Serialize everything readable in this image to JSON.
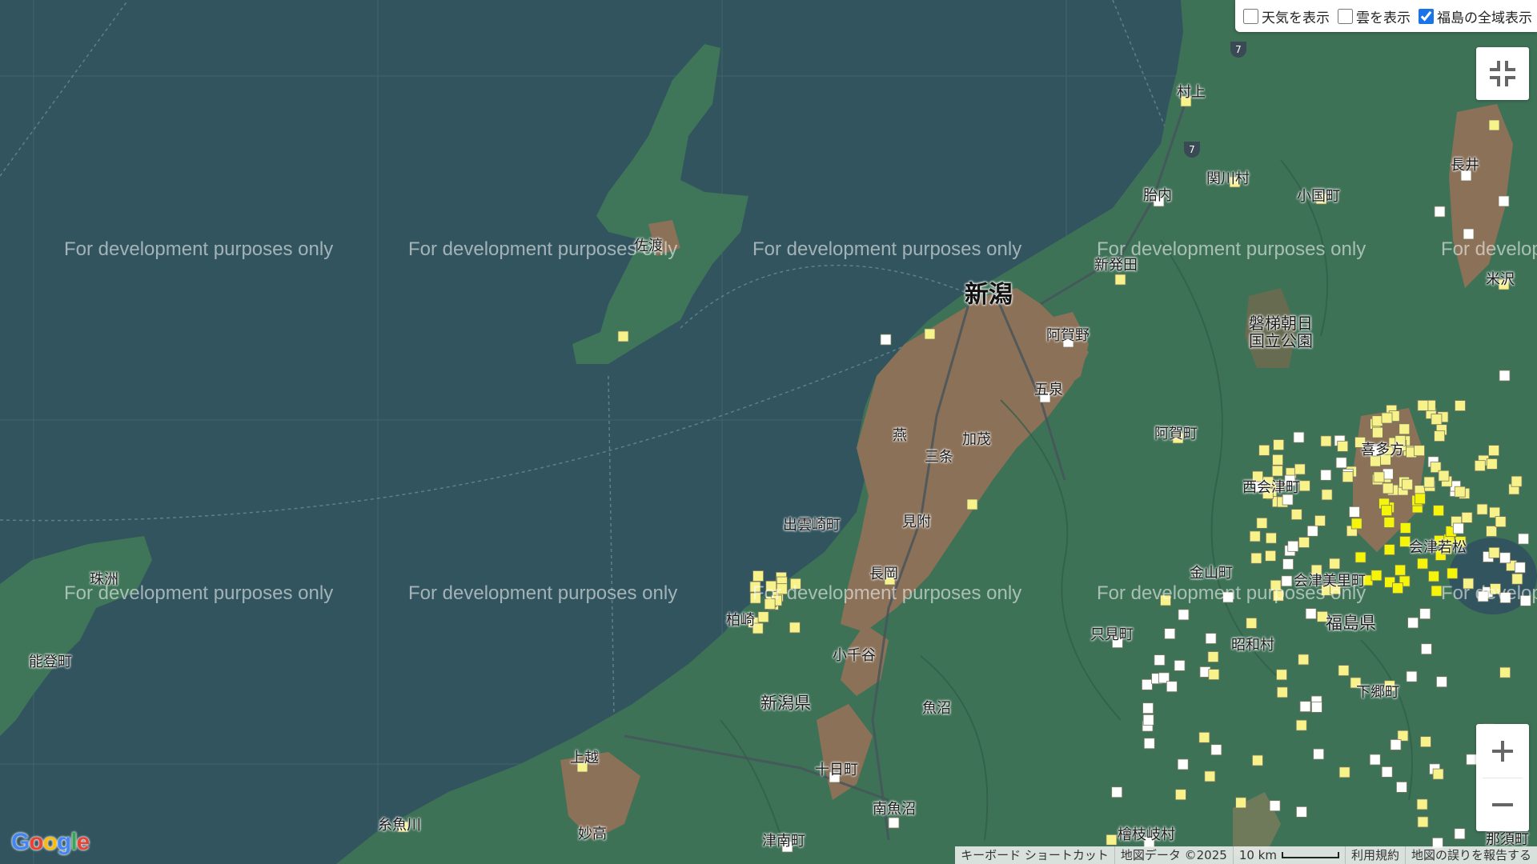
{
  "controls": {
    "weather": {
      "label": "天気を表示",
      "checked": false
    },
    "clouds": {
      "label": "雲を表示",
      "checked": false
    },
    "fukushima": {
      "label": "福島の全域表示",
      "checked": true
    }
  },
  "watermark": "For development purposes only",
  "map_labels": {
    "niigata_city": "新潟",
    "shibata": "新発田",
    "agano": "阿賀野",
    "gosen": "五泉",
    "tsubame": "燕",
    "kamo": "加茂",
    "sanjo": "三条",
    "mitsuke": "見附",
    "nagaoka": "長岡",
    "izumozaki": "出雲崎町",
    "kashiwazaki": "柏崎",
    "ojiya": "小千谷",
    "niigata_pref": "新潟県",
    "uonuma": "魚沼",
    "tokamachi": "十日町",
    "minamiuonuma": "南魚沼",
    "tsunan": "津南町",
    "joetsu": "上越",
    "myoko": "妙高",
    "itoigawa": "糸魚川",
    "sado": "佐渡",
    "murakami": "村上",
    "tainai": "胎内",
    "sekikawa": "関川村",
    "oguni": "小国町",
    "bandai_asahi": "磐梯朝日\n国立公園",
    "aga": "阿賀町",
    "nishiaizu": "西会津町",
    "kaneyama": "金山町",
    "aizumisato": "会津美里町",
    "tadami": "只見町",
    "showa": "昭和村",
    "fukushima_pref": "福島県",
    "shimogo": "下郷町",
    "hinoemata": "檜枝岐村",
    "nasu": "那須町",
    "nagai": "長井",
    "yonezawa": "米沢",
    "suzu": "珠洲",
    "noto": "能登町",
    "kitakata": "喜多方",
    "aizuwakamatsu": "会津若松"
  },
  "road_shields": [
    "7",
    "7"
  ],
  "zoom": {
    "in": "+",
    "out": "−"
  },
  "attribution": {
    "shortcuts": "キーボード ショートカット",
    "data": "地図データ ©2025",
    "scale": "10 km",
    "terms": "利用規約",
    "report": "地図の誤りを報告する"
  },
  "logo": "Google",
  "icons": {
    "fullscreen": "fullscreen-exit-icon",
    "zoom_in": "plus-icon",
    "zoom_out": "minus-icon"
  },
  "colors": {
    "sea": "#32545e",
    "land": "#3e7257",
    "urban": "#8b7158",
    "marker_yellow": "#f7f28a",
    "marker_white": "#ffffff",
    "marker_bright": "#f5f50a"
  }
}
